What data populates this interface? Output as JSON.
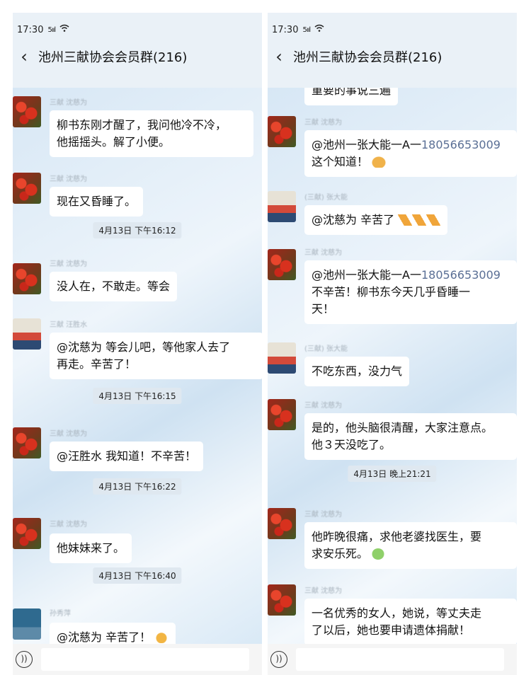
{
  "left": {
    "status_time": "17:30",
    "signal": "5ııl",
    "title": "池州三献协会会员群(216)",
    "senders": [
      "三献 沈慈为",
      "三献 沈慈为",
      "三献 沈慈为",
      "三献 汪胜水",
      "三献 沈慈为",
      "三献 沈慈为",
      "孙秀萍"
    ],
    "msg1_l1": "柳书东刚才醒了，我问他冷不冷，",
    "msg1_l2": "他摇摇头。解了小便。",
    "msg2": "现在又昏睡了。",
    "ts1": "4月13日 下午16:12",
    "msg3": "没人在，不敢走。等会",
    "msg4_l1": "@沈慈为  等会儿吧，等他家人去了",
    "msg4_l2": "再走。辛苦了！",
    "ts2": "4月13日 下午16:15",
    "msg5": "@汪胜水  我知道！不辛苦！",
    "ts3": "4月13日 下午16:22",
    "msg6": "他妹妹来了。",
    "ts4": "4月13日 下午16:40",
    "msg7": "@沈慈为  辛苦了！"
  },
  "right": {
    "status_time": "17:30",
    "signal": "5ııl",
    "title": "池州三献协会会员群(216)",
    "senders": [
      "三献 沈慈为",
      "(三献) 张大能",
      "三献 沈慈为",
      "(三献) 张大能",
      "三献 沈慈为",
      "三献 沈慈为",
      "三献 沈慈为"
    ],
    "msg0": "重要的事说三遍",
    "msg1_at": "@池州一张大能一A一",
    "msg1_phone": "18056653009",
    "msg1_l2": "这个知道！",
    "msg2": "@沈慈为  辛苦了",
    "msg3_at": "@池州一张大能一A一",
    "msg3_phone": "18056653009",
    "msg3_l2": "不辛苦！柳书东今天几乎昏睡一",
    "msg3_l3": "天！",
    "msg4": "不吃东西，没力气",
    "msg5_l1": "是的，他头脑很清醒，大家注意点。",
    "msg5_l2": "他３天没吃了。",
    "ts1": "4月13日 晚上21:21",
    "msg6_l1": "他昨晚很痛，求他老婆找医生，要",
    "msg6_l2": "求安乐死。",
    "msg7_l1": "一名优秀的女人，她说，等丈夫走",
    "msg7_l2": "了以后，她也要申请遗体捐献！"
  },
  "icons": {
    "back": "chevron-left-icon",
    "wifi": "wifi-icon",
    "voice": "voice-icon",
    "emoji_thumb": "thumbs-up-emoji",
    "emoji_handshake": "handshake-emoji",
    "emoji_pray": "pray-emoji",
    "emoji_sick": "sick-face-emoji"
  },
  "colors": {
    "chat_bg": "#eaf1f7",
    "bubble": "#ffffff",
    "timestamp_bg": "#dfe8f0",
    "phone_link": "#5a6f95"
  }
}
